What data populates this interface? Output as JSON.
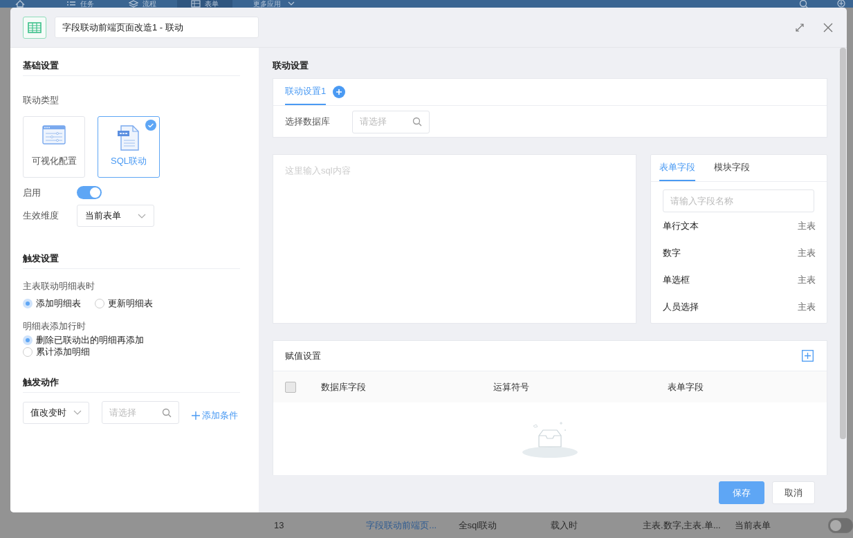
{
  "app_nav": {
    "items": [
      {
        "label": "任务",
        "kind": "list",
        "selected": false
      },
      {
        "label": "流程",
        "kind": "layers",
        "selected": false
      },
      {
        "label": "表单",
        "kind": "table",
        "selected": true
      },
      {
        "label": "更多应用",
        "kind": "more",
        "selected": false
      }
    ]
  },
  "dialog": {
    "title_value": "字段联动前端页面改造1 - 联动"
  },
  "basic_settings": {
    "heading": "基础设置",
    "type_label": "联动类型",
    "types": [
      {
        "label": "可视化配置",
        "kind": "visual",
        "selected": false
      },
      {
        "label": "SQL联动",
        "kind": "sql",
        "selected": true
      }
    ],
    "enable_label": "启用",
    "enabled": true,
    "scope_label": "生效维度",
    "scope_value": "当前表单"
  },
  "trigger_settings": {
    "heading": "触发设置",
    "groups": [
      {
        "label": "主表联动明细表时",
        "kind": "inline",
        "options": [
          {
            "label": "添加明细表",
            "selected": true
          },
          {
            "label": "更新明细表",
            "selected": false
          }
        ]
      },
      {
        "label": "明细表添加行时",
        "kind": "stacked",
        "options": [
          {
            "label": "删除已联动出的明细再添加",
            "selected": true
          },
          {
            "label": "累计添加明细",
            "selected": false
          }
        ]
      }
    ]
  },
  "trigger_action": {
    "heading": "触发动作",
    "event": "值改变时",
    "field_placeholder": "请选择",
    "add_link": "添加条件"
  },
  "linkage": {
    "heading": "联动设置",
    "tabs": [
      {
        "label": "联动设置1",
        "selected": true
      }
    ],
    "db_label": "选择数据库",
    "db_placeholder": "请选择",
    "sql_placeholder": "这里输入sql内容",
    "field_tabs": [
      {
        "label": "表单字段",
        "selected": true
      },
      {
        "label": "模块字段",
        "selected": false
      }
    ],
    "field_search_placeholder": "请输入字段名称",
    "fields": [
      {
        "name": "单行文本",
        "source": "主表"
      },
      {
        "name": "数字",
        "source": "主表"
      },
      {
        "name": "单选框",
        "source": "主表"
      },
      {
        "name": "人员选择",
        "source": "主表"
      }
    ]
  },
  "assignment": {
    "heading": "赋值设置",
    "select_all_checked": false,
    "columns": [
      "数据库字段",
      "运算符号",
      "表单字段"
    ]
  },
  "buttons": [
    {
      "label": "保存",
      "kind": "primary"
    },
    {
      "label": "取消",
      "kind": "default"
    }
  ],
  "background_row": {
    "cells": [
      {
        "text": "13",
        "kind": "plain"
      },
      {
        "text": "字段联动前端页...",
        "kind": "link"
      },
      {
        "text": "全sql联动",
        "kind": "plain"
      },
      {
        "text": "载入时",
        "kind": "plain"
      },
      {
        "text": "主表.数字,主表.单...",
        "kind": "plain"
      },
      {
        "text": "当前表单",
        "kind": "plain"
      }
    ],
    "toggle_on": false
  }
}
